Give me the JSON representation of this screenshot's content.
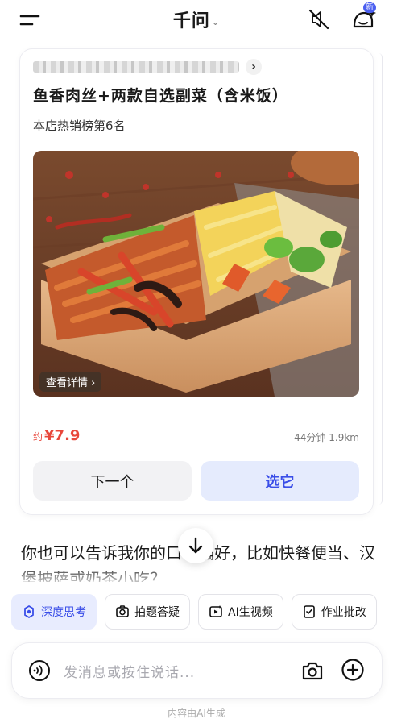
{
  "header": {
    "title": "千问",
    "title_chevron": "⌄",
    "new_badge": "新"
  },
  "card": {
    "store_name_blurred": true,
    "store_chevron": "›",
    "dish_name": "鱼香肉丝+两款自选副菜（含米饭）",
    "rank_text": "本店热销榜第6名",
    "photo_link": "查看详情 ›",
    "price_prefix": "约",
    "price": "¥7.9",
    "delivery_time": "44分钟",
    "distance": "1.9km",
    "next_button": "下一个",
    "pick_button": "选它"
  },
  "message": {
    "text": "你也可以告诉我你的口味偏好，比如快餐便当、汉堡披萨或奶茶小吃？"
  },
  "chips": [
    {
      "label": "深度思考",
      "icon": "deep-think-icon",
      "active": true
    },
    {
      "label": "拍题答疑",
      "icon": "photo-question-icon",
      "active": false
    },
    {
      "label": "AI生视频",
      "icon": "ai-video-icon",
      "active": false
    },
    {
      "label": "作业批改",
      "icon": "homework-icon",
      "active": false
    }
  ],
  "input": {
    "placeholder": "发消息或按住说话..."
  },
  "footer": {
    "disclaimer": "内容由AI生成"
  },
  "colors": {
    "accent": "#3a4ee8",
    "price": "#e8473b",
    "chip_active_bg": "#e8ecfe"
  }
}
